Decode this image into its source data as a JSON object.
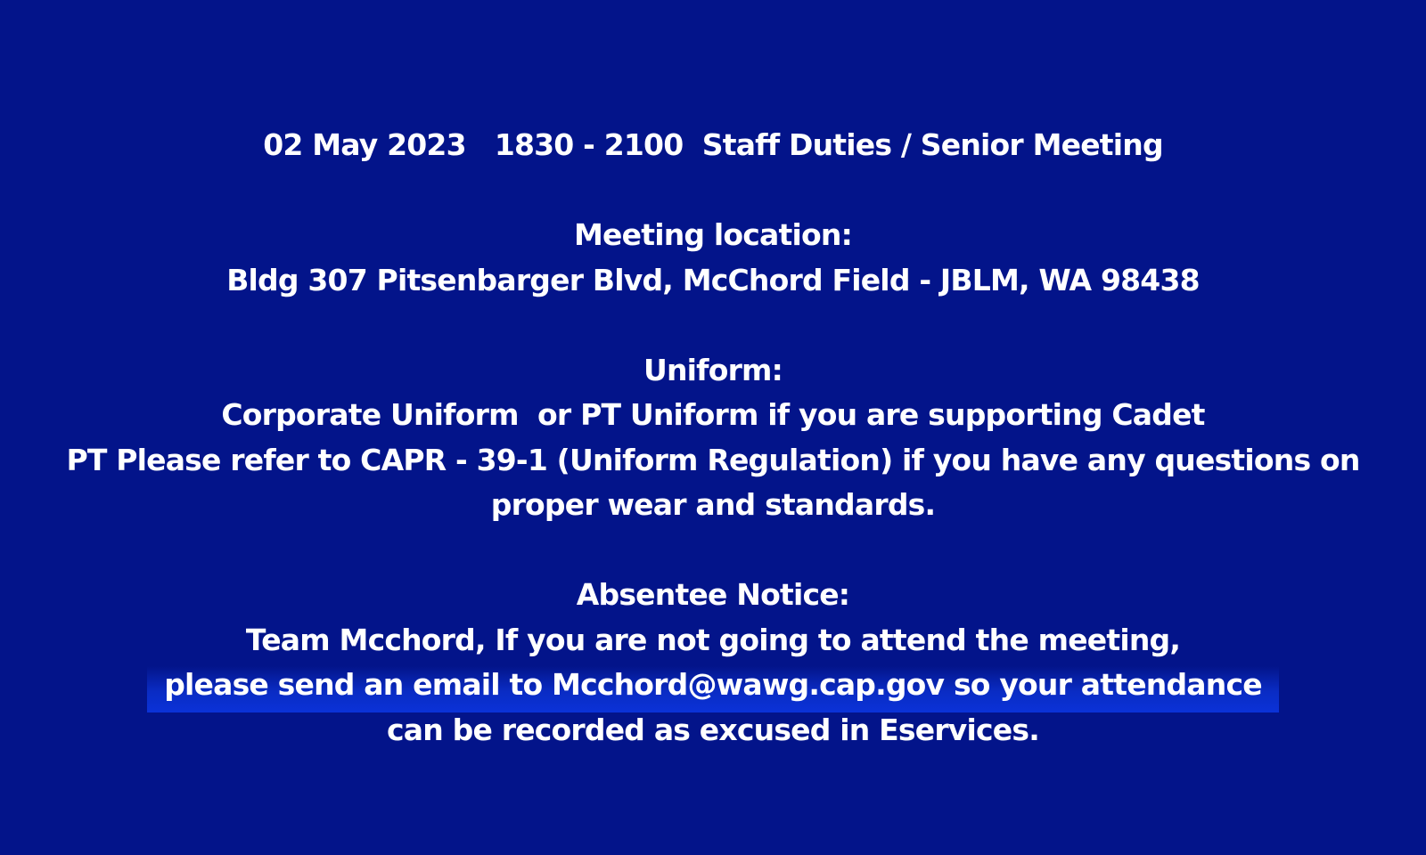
{
  "header": {
    "event_line": "02 May 2023   1830 - 2100  Staff Duties / Senior Meeting"
  },
  "location": {
    "heading": "Meeting location:",
    "address": "Bldg 307 Pitsenbarger Blvd, McChord Field - JBLM, WA 98438"
  },
  "uniform": {
    "heading": "Uniform:",
    "lines": [
      "Corporate Uniform  or PT Uniform if you are supporting Cadet",
      "PT Please refer to CAPR - 39-1 (Uniform Regulation) if you have any questions on",
      "proper wear and standards."
    ]
  },
  "absentee": {
    "heading": "Absentee Notice:",
    "lines": [
      "Team Mcchord, If you are not going to attend the meeting,",
      "please send an email to Mcchord@wawg.cap.gov so your attendance",
      "can be recorded as excused in Eservices."
    ]
  },
  "colors": {
    "background": "#03148a",
    "text": "#ffffff",
    "highlight": "#0b32d8"
  }
}
